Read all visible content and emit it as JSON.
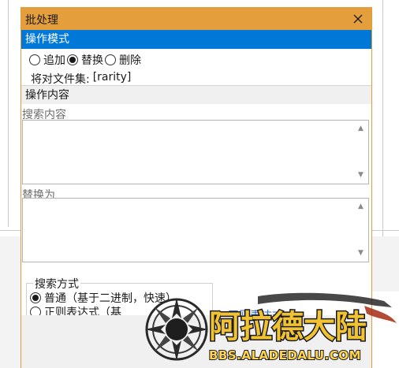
{
  "dialog": {
    "title": "批处理"
  },
  "mode_section": {
    "header": "操作模式",
    "options": [
      {
        "label": "追加",
        "checked": false
      },
      {
        "label": "替换",
        "checked": true
      },
      {
        "label": "删除",
        "checked": false
      }
    ],
    "set_label": "将对文件集:",
    "set_value": "[rarity]"
  },
  "content_section": {
    "header": "操作内容",
    "search_label": "搜索内容",
    "search_value": "",
    "replace_label": "替换为",
    "replace_value": ""
  },
  "search_method": {
    "title": "搜索方式",
    "options": [
      {
        "label": "普通（基于二进制，快速）",
        "checked": true
      },
      {
        "label": "正则表达式（基",
        "checked": false
      }
    ],
    "link_text": "正则表达式"
  },
  "watermark": {
    "logo_text": "阿拉德大陆",
    "url": "BBS.ALADEDALU.COM"
  }
}
